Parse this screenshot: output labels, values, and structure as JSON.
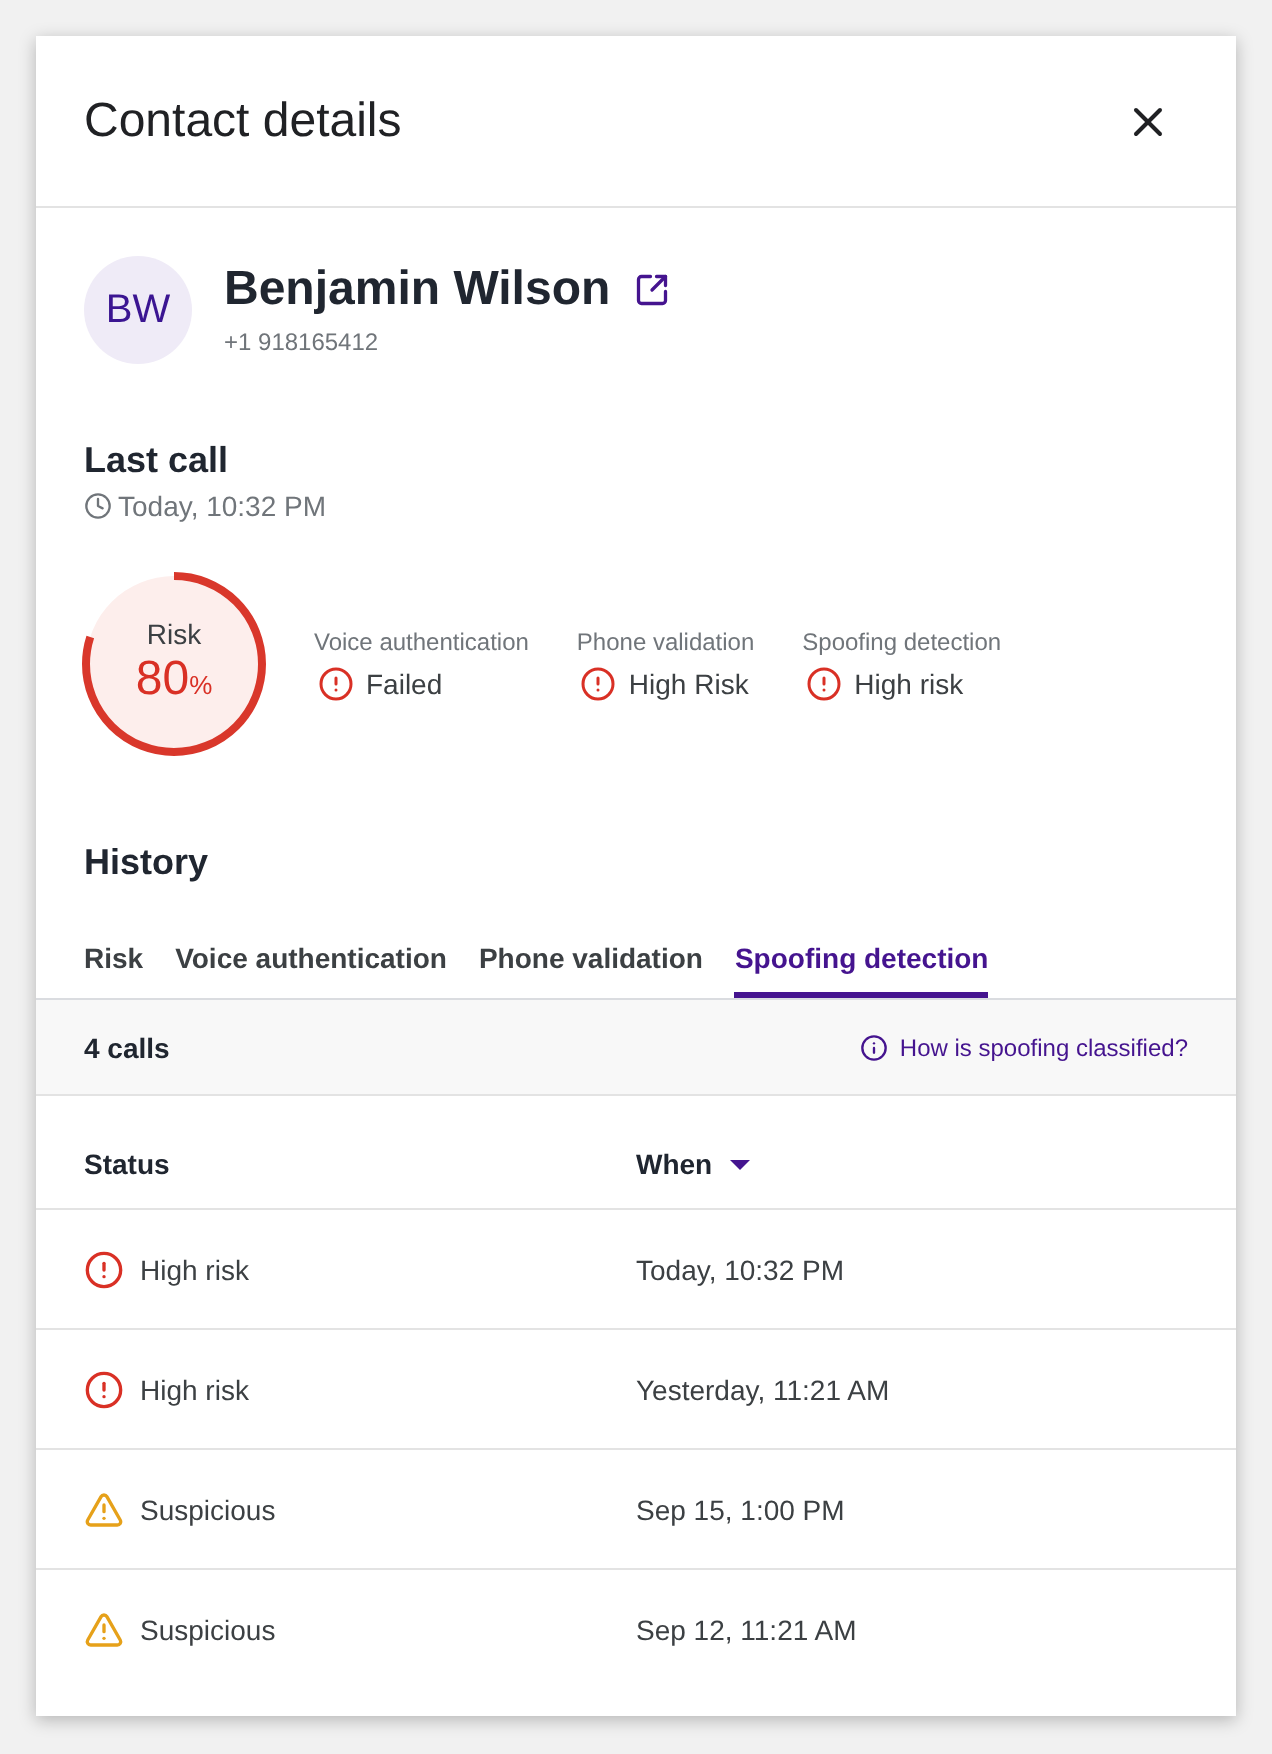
{
  "panel": {
    "title": "Contact details"
  },
  "contact": {
    "initials": "BW",
    "name": "Benjamin Wilson",
    "phone": "+1 918165412"
  },
  "last_call": {
    "heading": "Last call",
    "time": "Today, 10:32 PM",
    "risk": {
      "label": "Risk",
      "value": "80",
      "unit": "%",
      "level": 0.8
    },
    "checks": [
      {
        "label": "Voice authentication",
        "result": "Failed",
        "kind": "error"
      },
      {
        "label": "Phone validation",
        "result": "High Risk",
        "kind": "error"
      },
      {
        "label": "Spoofing detection",
        "result": "High risk",
        "kind": "error"
      }
    ]
  },
  "history": {
    "heading": "History",
    "tabs": [
      {
        "label": "Risk",
        "selected": false
      },
      {
        "label": "Voice authentication",
        "selected": false
      },
      {
        "label": "Phone validation",
        "selected": false
      },
      {
        "label": "Spoofing detection",
        "selected": true
      }
    ],
    "summary": "4 calls",
    "help_link": "How is spoofing classified?",
    "table": {
      "columns": [
        {
          "label": "Status",
          "sorted": false
        },
        {
          "label": "When",
          "sorted": true
        }
      ],
      "rows": [
        {
          "status": "High risk",
          "kind": "error",
          "when": "Today, 10:32 PM"
        },
        {
          "status": "High risk",
          "kind": "error",
          "when": "Yesterday, 11:21 AM"
        },
        {
          "status": "Suspicious",
          "kind": "warning",
          "when": "Sep 15, 1:00 PM"
        },
        {
          "status": "Suspicious",
          "kind": "warning",
          "when": "Sep 12, 11:21 AM"
        }
      ]
    }
  }
}
